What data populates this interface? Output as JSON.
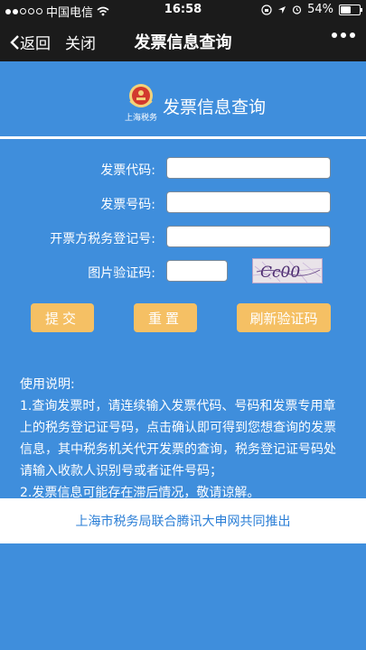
{
  "status_bar": {
    "carrier": "中国电信",
    "time": "16:58",
    "battery": "54%",
    "battery_level": 0.54
  },
  "nav": {
    "back_label": "返回",
    "close_label": "关闭",
    "title": "发票信息查询"
  },
  "header": {
    "emblem_text": "上海税务",
    "title": "发票信息查询"
  },
  "form": {
    "invoice_code_label": "发票代码:",
    "invoice_code_value": "",
    "invoice_number_label": "发票号码:",
    "invoice_number_value": "",
    "issuer_tax_id_label": "开票方税务登记号:",
    "issuer_tax_id_value": "",
    "captcha_label": "图片验证码:",
    "captcha_value": "",
    "captcha_image_text": "Cc00"
  },
  "buttons": {
    "submit": "提交",
    "reset": "重置",
    "refresh_captcha": "刷新验证码"
  },
  "instructions": {
    "title": "使用说明:",
    "item1": "1.查询发票时，请连续输入发票代码、号码和发票专用章上的税务登记证号码，点击确认即可得到您想查询的发票信息，其中税务机关代开发票的查询，税务登记证号码处请输入收款人识别号或者证件号码；",
    "item2": "2.发票信息可能存在滞后情况，敬请谅解。"
  },
  "footer": {
    "text": "上海市税务局联合腾讯大申网共同推出"
  },
  "colors": {
    "background": "#3f8edc",
    "bar": "#1b1b1b",
    "button": "#f5c064",
    "footer_text": "#2a7ed6"
  }
}
